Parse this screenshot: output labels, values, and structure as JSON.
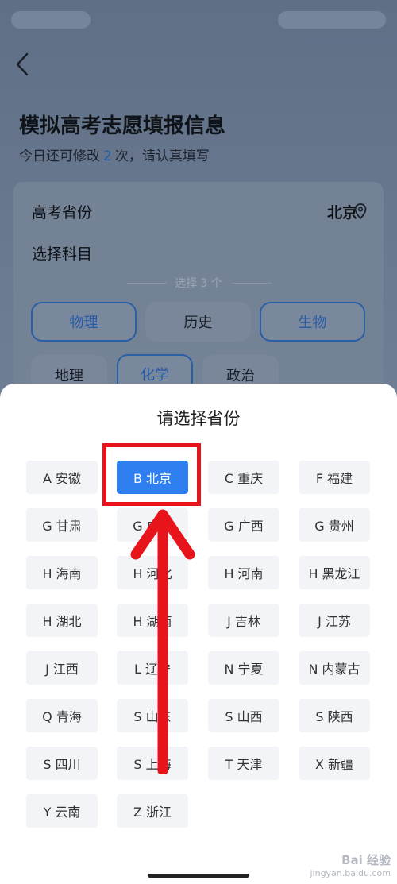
{
  "header": {
    "title": "模拟高考志愿填报信息",
    "subtitle_prefix": "今日还可修改",
    "subtitle_count": "2",
    "subtitle_suffix": "次，请认真填写"
  },
  "form": {
    "province_label": "高考省份",
    "province_value": "北京",
    "subject_label": "选择科目",
    "subject_hint": "选择 3 个",
    "subjects": [
      {
        "label": "物理",
        "selected": true
      },
      {
        "label": "历史",
        "selected": false
      },
      {
        "label": "生物",
        "selected": true
      },
      {
        "label": "地理",
        "selected": false
      },
      {
        "label": "化学",
        "selected": true
      },
      {
        "label": "政治",
        "selected": false
      }
    ]
  },
  "sheet": {
    "title": "请选择省份",
    "provinces": [
      "A 安徽",
      "B 北京",
      "C 重庆",
      "F 福建",
      "G 甘肃",
      "G 广东",
      "G 广西",
      "G 贵州",
      "H 海南",
      "H 河北",
      "H 河南",
      "H 黑龙江",
      "H 湖北",
      "H 湖南",
      "J 吉林",
      "J 江苏",
      "J 江西",
      "L 辽宁",
      "N 宁夏",
      "N 内蒙古",
      "Q 青海",
      "S 山东",
      "S 山西",
      "S 陕西",
      "S 四川",
      "S 上海",
      "T 天津",
      "X 新疆",
      "Y 云南",
      "Z 浙江"
    ],
    "selected_index": 1
  },
  "annotation": {
    "color": "#e8141b"
  },
  "watermark": {
    "brand": "Bai 经验",
    "url": "jingyan.baidu.com"
  }
}
